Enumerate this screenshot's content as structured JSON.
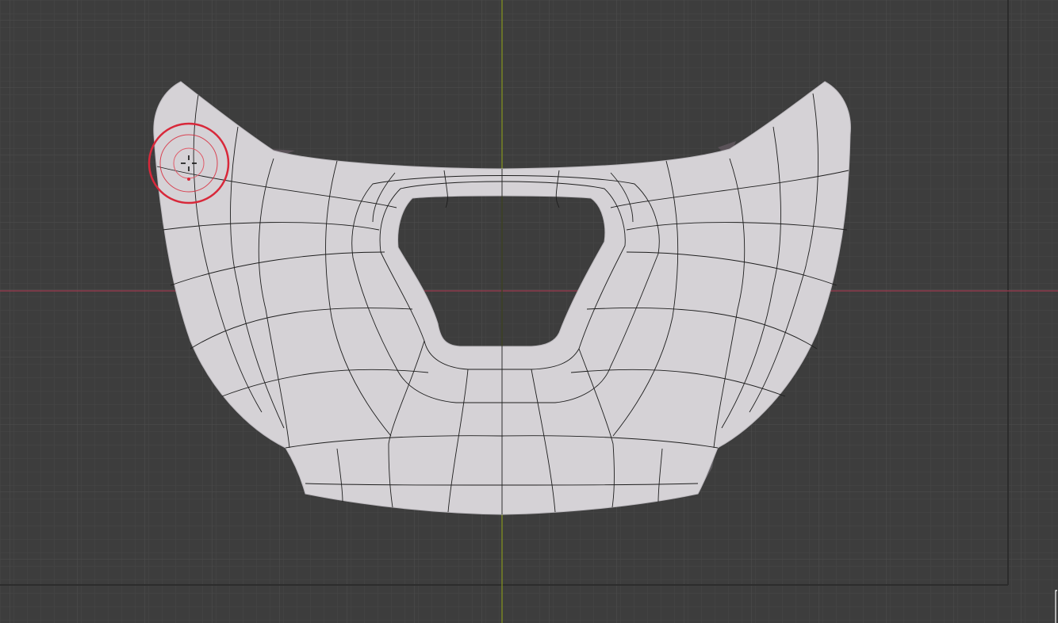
{
  "viewport": {
    "view": "top-orthographic",
    "object": "mesh-surface",
    "active_tool": "sculpt-brush",
    "colors": {
      "background": "#3d3d3d",
      "grid_minor": "#474747",
      "grid_major": "#525252",
      "x_axis": "#9c3a4e",
      "y_axis": "#7f8f21",
      "mesh_fill": "#d5d2d6",
      "wire": "#1e1e1e",
      "brush_ring": "#d8283a"
    }
  }
}
